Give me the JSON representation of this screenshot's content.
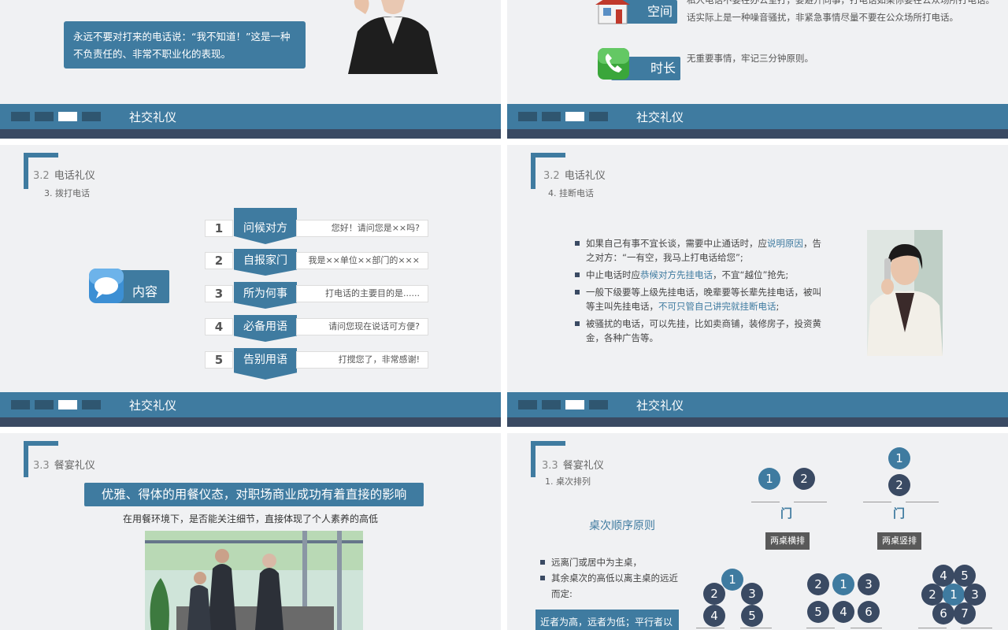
{
  "footer_label": "社交礼仪",
  "slide1": {
    "quote": "永远不要对打来的电话说：“我不知道！”这是一种不负责任的、非常不职业化的表现。"
  },
  "slide2": {
    "top_text": "私人电话不要在办公室打，要避开同事，打电话如果你要在公众场所打电话。",
    "space_label": "空间",
    "space_text": "话实际上是一种噪音骚扰，非紧急事情尽量不要在公众场所打电话。",
    "time_label": "时长",
    "time_text": "无重要事情，牢记三分钟原则。"
  },
  "slide3": {
    "section_num": "3.2",
    "section_title": "电话礼仪",
    "subtitle": "3. 拨打电话",
    "content_label": "内容",
    "steps": [
      {
        "n": "1",
        "label": "问候对方",
        "text": "您好！请问您是××吗?"
      },
      {
        "n": "2",
        "label": "自报家门",
        "text": "我是××单位××部门的×××"
      },
      {
        "n": "3",
        "label": "所为何事",
        "text": "打电话的主要目的是......"
      },
      {
        "n": "4",
        "label": "必备用语",
        "text": "请问您现在说话可方便?"
      },
      {
        "n": "5",
        "label": "告别用语",
        "text": "打搅您了，非常感谢!"
      }
    ]
  },
  "slide4": {
    "section_num": "3.2",
    "section_title": "电话礼仪",
    "subtitle": "4. 挂断电话",
    "b1_a": "如果自己有事不宜长谈，需要中止通话时，应",
    "b1_hl": "说明原因",
    "b1_b": "，告之对方：“一有空，我马上打电话给您”;",
    "b2_a": "中止电话时应",
    "b2_hl": "恭候对方先挂电话",
    "b2_b": "，不宜“越位”抢先;",
    "b3_a": "一般下级要等上级先挂电话，晚辈要等长辈先挂电话，被叫等主叫先挂电话，",
    "b3_hl": "不可只管自己讲完就挂断电话",
    "b3_b": ";",
    "b4": "被骚扰的电话，可以先挂，比如卖商铺，装修房子，投资黄金，各种广告等。"
  },
  "slide5": {
    "section_num": "3.3",
    "section_title": "餐宴礼仪",
    "headline": "优雅、得体的用餐仪态，对职场商业成功有着直接的影响",
    "subline": "在用餐环境下，是否能关注细节，直接体现了个人素养的高低"
  },
  "slide6": {
    "section_num": "3.3",
    "section_title": "餐宴礼仪",
    "subtitle": "1. 桌次排列",
    "principle": "桌次顺序原则",
    "b1": "远离门或居中为主桌，",
    "b2": "其余桌次的高低以离主桌的远近而定:",
    "note": "近者为高，远者为低；平行者以",
    "door": "门",
    "label_h": "两桌横排",
    "label_v": "两桌竖排",
    "n1": "1",
    "n2": "2",
    "n3": "3",
    "n4": "4",
    "n5": "5",
    "n6": "6",
    "n7": "7"
  },
  "colors": {
    "primary": "#3f7ba0",
    "dark": "#3a4a63",
    "bg": "#f0f1f3"
  }
}
